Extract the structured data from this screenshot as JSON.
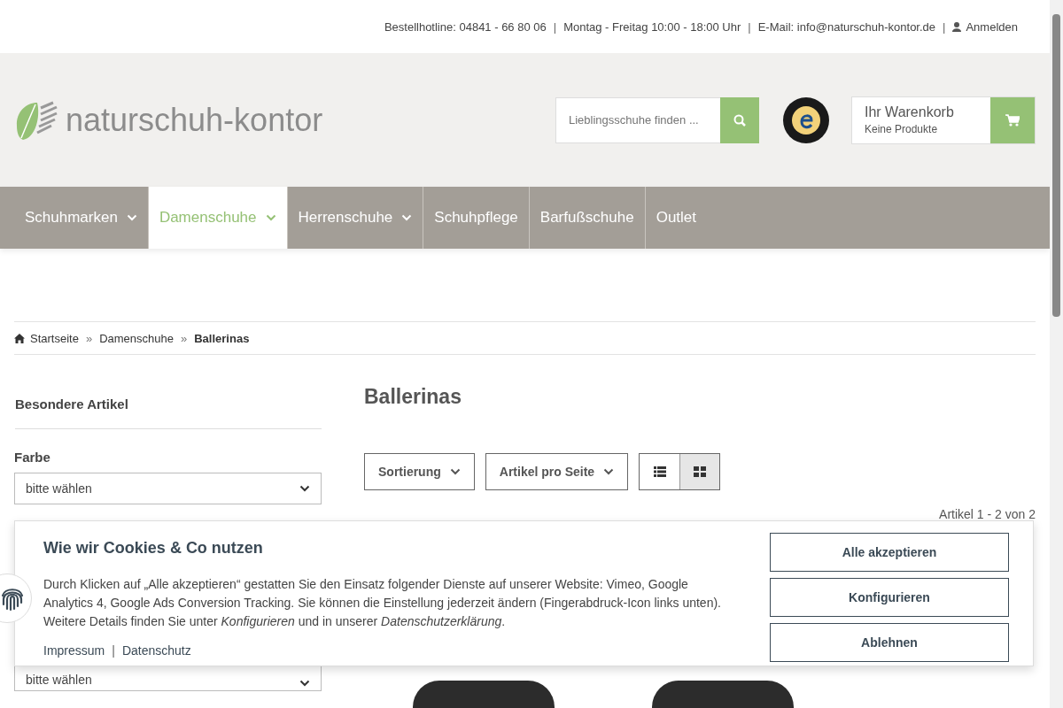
{
  "topbar": {
    "items": [
      {
        "kind": "text",
        "text": "Bestellhotline: 04841 - 66 80 06"
      },
      {
        "kind": "separator",
        "text": "|"
      },
      {
        "kind": "text",
        "text": "Montag - Freitag 10:00 - 18:00 Uhr"
      },
      {
        "kind": "separator",
        "text": "|"
      },
      {
        "kind": "text",
        "text": "E-Mail: info@naturschuh-kontor.de"
      },
      {
        "kind": "separator",
        "text": "|"
      },
      {
        "kind": "login",
        "text": "Anmelden"
      }
    ]
  },
  "header": {
    "logo_text": "naturschuh-kontor",
    "search": {
      "placeholder": "Lieblingsschuhe finden ..."
    },
    "cart": {
      "title": "Ihr Warenkorb",
      "subtitle": "Keine Produkte"
    }
  },
  "nav": [
    {
      "label": "Schuhmarken",
      "dropdown": true,
      "selected": false
    },
    {
      "label": "Damenschuhe",
      "dropdown": true,
      "selected": true
    },
    {
      "label": "Herrenschuhe",
      "dropdown": true,
      "selected": false
    },
    {
      "label": "Schuhpflege",
      "dropdown": false,
      "selected": false
    },
    {
      "label": "Barfußschuhe",
      "dropdown": false,
      "selected": false
    },
    {
      "label": "Outlet",
      "dropdown": false,
      "selected": false
    }
  ],
  "breadcrumb": [
    {
      "label": "Startseite",
      "current": false
    },
    {
      "label": "Damenschuhe",
      "separator": "»",
      "current": false
    },
    {
      "label": "Ballerinas",
      "separator": "»",
      "current": true
    }
  ],
  "sidebar": {
    "heading": "Besondere Artikel",
    "filters": [
      {
        "label": "Farbe",
        "value": "bitte wählen"
      },
      {
        "value": "bitte wählen"
      }
    ]
  },
  "main": {
    "title": "Ballerinas",
    "sort_label": "Sortierung",
    "per_page_label": "Artikel pro Seite",
    "views": [
      {
        "kind": "list",
        "selected": false
      },
      {
        "kind": "grid",
        "selected": true
      }
    ],
    "count": "Artikel 1 - 2 von 2"
  },
  "cookie_banner": {
    "title": "Wie wir Cookies & Co nutzen",
    "text": "Durch Klicken auf „Alle akzeptieren“ gestatten Sie den Einsatz folgender Dienste auf unserer Website: Vimeo, Google Analytics 4, Google Ads Conversion Tracking. Sie können die Einstellung jederzeit ändern (Fingerabdruck-Icon links unten). Weitere Details finden Sie unter *Konfigurieren* und in unserer *Datenschutzerklärung*.",
    "links": [
      {
        "kind": "link",
        "text": "Impressum"
      },
      {
        "kind": "separator",
        "text": "|"
      },
      {
        "kind": "link",
        "text": "Datenschutz"
      }
    ],
    "buttons": [
      "Alle akzeptieren",
      "Konfigurieren",
      "Ablehnen"
    ]
  }
}
